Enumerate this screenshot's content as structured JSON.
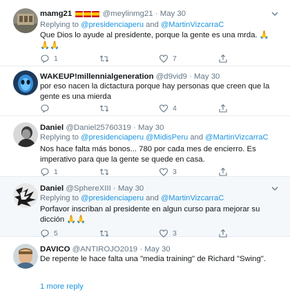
{
  "tweets": [
    {
      "name": "mamg21",
      "flags": [
        "es",
        "es",
        "es"
      ],
      "handle": "@meylinmg21",
      "dot": "·",
      "date": "May 30",
      "replying_prefix": "Replying to",
      "mention1": "@presidenciaperu",
      "and": "and",
      "mention2": "@MartinVizcarraC",
      "text": "Que Dios lo ayude al presidente, porque la gente es una mrda. 🙏🙏🙏",
      "replies": "1",
      "retweets": "",
      "likes": "7"
    },
    {
      "name": "WAKEUP!millennialgeneration",
      "handle": "@d9vid9",
      "dot": "·",
      "date": "May 30",
      "text": "por eso nacen la dictactura porque hay personas que creen que la gente es una mierda",
      "replies": "",
      "retweets": "",
      "likes": "4"
    },
    {
      "name": "Daniel",
      "handle": "@Daniel25760319",
      "dot": "·",
      "date": "May 30",
      "replying_prefix": "Replying to",
      "mention1": "@presidenciaperu",
      "mention_mid": "@MidisPeru",
      "and": "and",
      "mention2": "@MartinVizcarraC",
      "text": "Nos hace falta más bonos... 780 por cada mes de encierro. Es imperativo para que la gente se quede en casa.",
      "replies": "1",
      "retweets": "",
      "likes": "3"
    },
    {
      "name": "Daniel",
      "handle": "@SphereXIII",
      "dot": "·",
      "date": "May 30",
      "replying_prefix": "Replying to",
      "mention1": "@presidenciaperu",
      "and": "and",
      "mention2": "@MartinVizcarraC",
      "text": "Porfavor inscriban al presidente en algun curso para mejorar su dicción 🙏🙏",
      "replies": "5",
      "retweets": "",
      "likes": "3"
    },
    {
      "name": "DAVICO",
      "handle": "@ANTIROJO2019",
      "dot": "·",
      "date": "May 30",
      "text": "De repente le hace falta una \"media training\" de Richard \"Swing\"."
    }
  ],
  "more_replies": "1 more reply",
  "colors": {
    "link": "#1b95e0",
    "muted": "#657786",
    "hover_bg": "#f5f8fa",
    "divider": "#e6ecf0"
  },
  "icons": [
    "reply-icon",
    "retweet-icon",
    "like-icon",
    "share-icon",
    "chevron-down-icon"
  ]
}
